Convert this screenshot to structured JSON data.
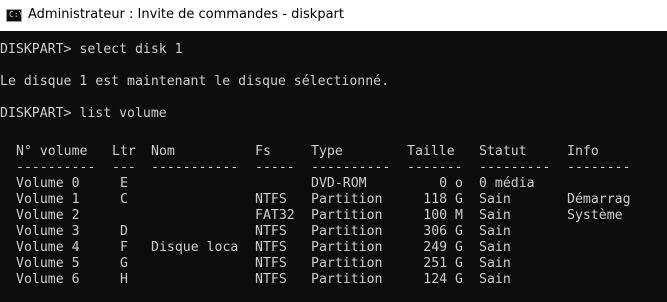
{
  "window": {
    "title": "Administrateur : Invite de commandes - diskpart",
    "icon": "terminal-icon"
  },
  "console": {
    "prompt1": "DISKPART> select disk 1",
    "message": "Le disque 1 est maintenant le disque sélectionné.",
    "prompt2": "DISKPART> list volume",
    "headers": [
      "N° volume",
      "Ltr",
      "Nom",
      "Fs",
      "Type",
      "Taille",
      "Statut",
      "Info"
    ],
    "separators": [
      "----------",
      "---",
      "-----------",
      "-----",
      "----------",
      "-------",
      "---------",
      "--------"
    ],
    "rows": [
      [
        "Volume 0",
        "E",
        "",
        "",
        "DVD-ROM",
        "0 o",
        "0 média",
        ""
      ],
      [
        "Volume 1",
        "C",
        "",
        "NTFS",
        "Partition",
        "118 G",
        "Sain",
        "Démarrag"
      ],
      [
        "Volume 2",
        "",
        "",
        "FAT32",
        "Partition",
        "100 M",
        "Sain",
        "Système"
      ],
      [
        "Volume 3",
        "D",
        "",
        "NTFS",
        "Partition",
        "306 G",
        "Sain",
        ""
      ],
      [
        "Volume 4",
        "F",
        "Disque loca",
        "NTFS",
        "Partition",
        "249 G",
        "Sain",
        ""
      ],
      [
        "Volume 5",
        "G",
        "",
        "NTFS",
        "Partition",
        "251 G",
        "Sain",
        ""
      ],
      [
        "Volume 6",
        "H",
        "",
        "NTFS",
        "Partition",
        "124 G",
        "Sain",
        ""
      ]
    ]
  }
}
